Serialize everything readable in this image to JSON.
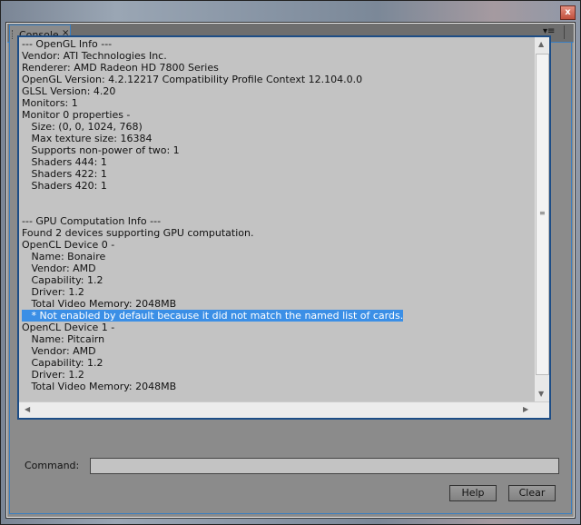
{
  "window": {
    "close_glyph": "x"
  },
  "tab": {
    "label": "Console",
    "close_glyph": "×"
  },
  "panel_menu_glyph": "▾≡",
  "console_lines": [
    "--- OpenGL Info ---",
    "Vendor: ATI Technologies Inc.",
    "Renderer: AMD Radeon HD 7800 Series",
    "OpenGL Version: 4.2.12217 Compatibility Profile Context 12.104.0.0",
    "GLSL Version: 4.20",
    "Monitors: 1",
    "Monitor 0 properties -",
    "   Size: (0, 0, 1024, 768)",
    "   Max texture size: 16384",
    "   Supports non-power of two: 1",
    "   Shaders 444: 1",
    "   Shaders 422: 1",
    "   Shaders 420: 1",
    "",
    "",
    "--- GPU Computation Info ---",
    "Found 2 devices supporting GPU computation.",
    "OpenCL Device 0 -",
    "   Name: Bonaire",
    "   Vendor: AMD",
    "   Capability: 1.2",
    "   Driver: 1.2",
    "   Total Video Memory: 2048MB",
    "   * Not enabled by default because it did not match the named list of cards.",
    "OpenCL Device 1 -",
    "   Name: Pitcairn",
    "   Vendor: AMD",
    "   Capability: 1.2",
    "   Driver: 1.2",
    "   Total Video Memory: 2048MB"
  ],
  "selected_line_index": 23,
  "command": {
    "label": "Command:",
    "value": ""
  },
  "buttons": {
    "help": "Help",
    "clear": "Clear"
  }
}
